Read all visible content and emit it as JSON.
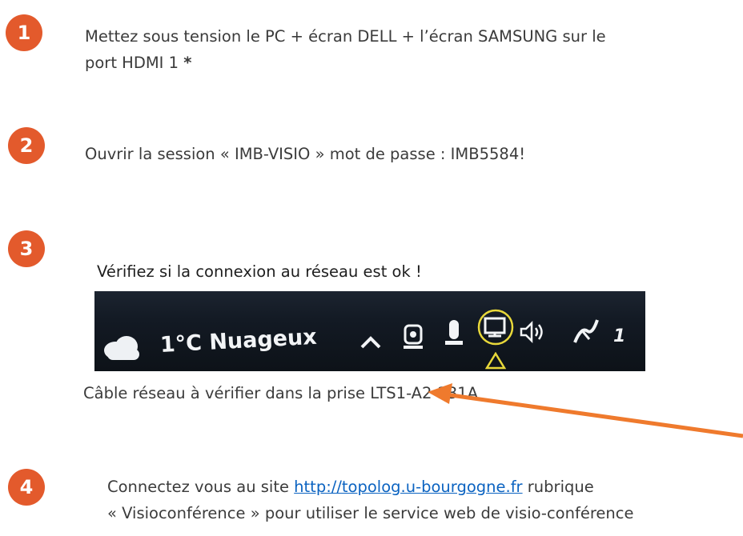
{
  "steps": [
    {
      "number": "1",
      "line1": "Mettez sous tension le PC + écran DELL + l’écran SAMSUNG sur le",
      "line2": "port HDMI 1 ",
      "star": "*"
    },
    {
      "number": "2",
      "text": "Ouvrir la session « IMB-VISIO » mot de passe : IMB5584!"
    },
    {
      "number": "3",
      "text": "Vérifiez si la connexion au réseau est ok !"
    },
    {
      "number": "4",
      "line1_before": "Connectez vous au site ",
      "link": "http://topolog.u-bourgogne.fr",
      "line1_after": " rubrique",
      "line2": "« Visioconférence » pour utiliser le service web de visio-conférence"
    }
  ],
  "taskbar": {
    "weather": "1°C Nuageux",
    "clock_partial": "1",
    "icons": [
      "cloud-icon",
      "chevron-up-icon",
      "webcam-icon",
      "microphone-icon",
      "network-icon",
      "speaker-icon",
      "pen-icon",
      "warning-triangle-icon"
    ],
    "highlight_color": "#e8d83a"
  },
  "caption": "Câble réseau à vérifier dans la prise LTS1-A2-231A",
  "colors": {
    "badge": "#e35a2c",
    "arrow": "#ef7a2d",
    "link": "#0b63c1"
  }
}
